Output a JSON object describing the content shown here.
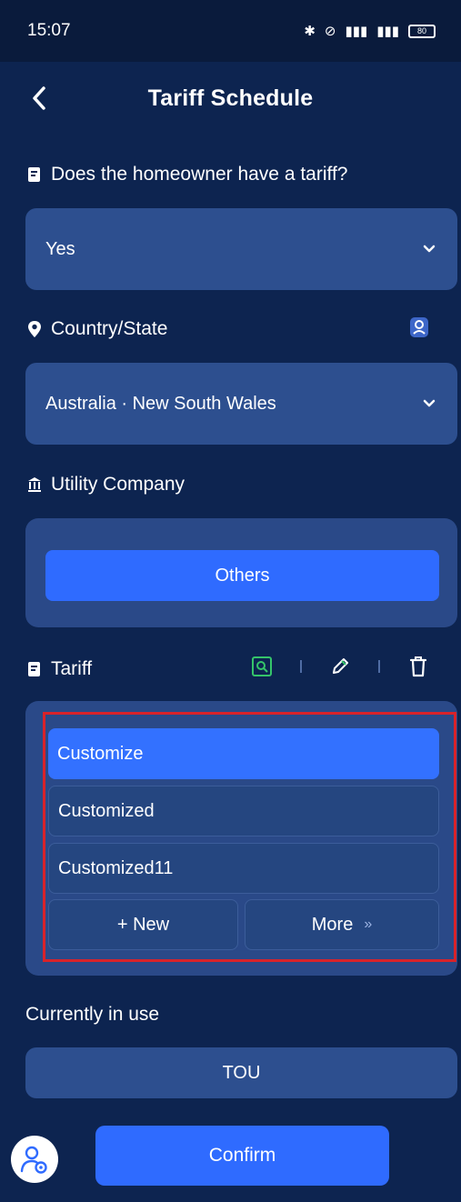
{
  "status_bar": {
    "time": "15:07",
    "battery": "80"
  },
  "header": {
    "title": "Tariff Schedule"
  },
  "homeowner_tariff": {
    "label": "Does the homeowner have a tariff?",
    "value": "Yes"
  },
  "country_state": {
    "label": "Country/State",
    "value": "Australia · New South Wales"
  },
  "utility_company": {
    "label": "Utility Company",
    "button_label": "Others"
  },
  "tariff": {
    "label": "Tariff",
    "items": [
      {
        "label": "Customize",
        "selected": true
      },
      {
        "label": "Customized",
        "selected": false
      },
      {
        "label": "Customized11",
        "selected": false
      }
    ],
    "new_label": "+ New",
    "more_label": "More",
    "more_icon": "»"
  },
  "currently_in_use": {
    "label": "Currently in use",
    "value": "TOU"
  },
  "confirm_label": "Confirm",
  "colors": {
    "background": "#0d2450",
    "panel": "#2a4988",
    "accent": "#2f6bff",
    "highlight": "#d8232a"
  }
}
